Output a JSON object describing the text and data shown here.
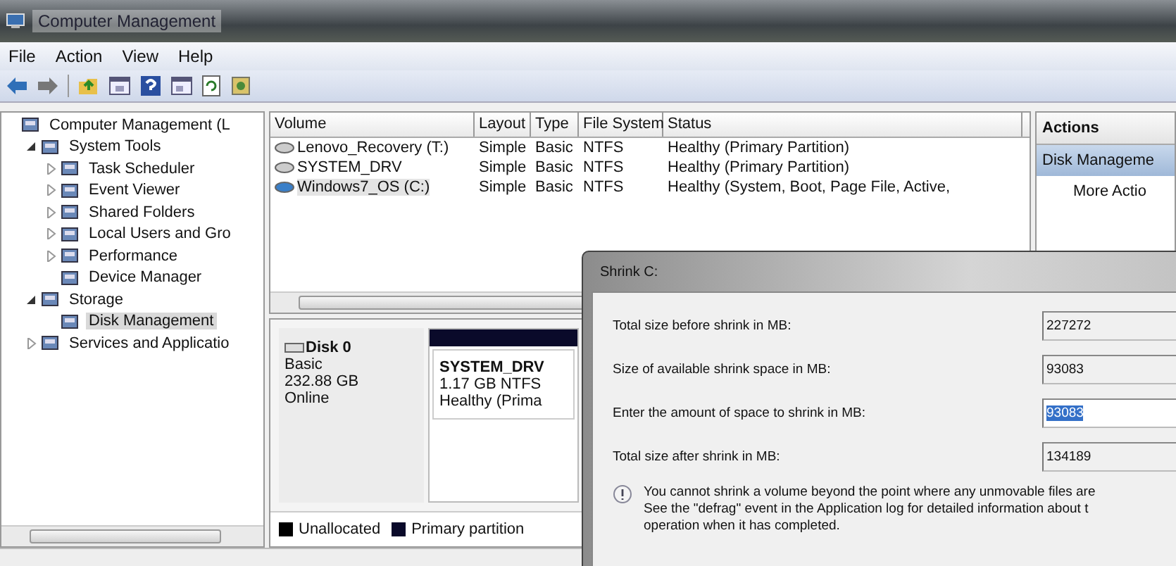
{
  "window": {
    "title": "Computer Management"
  },
  "menu": [
    {
      "label": "File"
    },
    {
      "label": "Action"
    },
    {
      "label": "View"
    },
    {
      "label": "Help"
    }
  ],
  "tree": [
    {
      "label": "Computer Management (L",
      "selected": false,
      "children": [
        {
          "label": "System Tools",
          "selected": false,
          "expanded": true,
          "children": [
            {
              "label": "Task Scheduler",
              "selected": false,
              "expanded": false
            },
            {
              "label": "Event Viewer",
              "selected": false,
              "expanded": false
            },
            {
              "label": "Shared Folders",
              "selected": false,
              "expanded": false
            },
            {
              "label": "Local Users and Gro",
              "selected": false,
              "expanded": false
            },
            {
              "label": "Performance",
              "selected": false,
              "expanded": false
            },
            {
              "label": "Device Manager",
              "selected": false
            }
          ]
        },
        {
          "label": "Storage",
          "selected": false,
          "expanded": true,
          "children": [
            {
              "label": "Disk Management",
              "selected": true
            }
          ]
        },
        {
          "label": "Services and Applicatio",
          "selected": false,
          "expanded": false
        }
      ]
    }
  ],
  "volumes": {
    "columns": [
      "Volume",
      "Layout",
      "Type",
      "File System",
      "Status"
    ],
    "rows": [
      {
        "cells": [
          "Lenovo_Recovery (T:)",
          "Simple",
          "Basic",
          "NTFS",
          "Healthy (Primary Partition)"
        ],
        "selected": false
      },
      {
        "cells": [
          "SYSTEM_DRV",
          "Simple",
          "Basic",
          "NTFS",
          "Healthy (Primary Partition)"
        ],
        "selected": false
      },
      {
        "cells": [
          "Windows7_OS (C:)",
          "Simple",
          "Basic",
          "NTFS",
          "Healthy (System, Boot, Page File, Active,"
        ],
        "selected": true
      }
    ]
  },
  "actions": {
    "title": "Actions",
    "items": [
      {
        "label": "Disk Manageme",
        "kind": "section"
      },
      {
        "label": "More Actio",
        "kind": "action"
      }
    ]
  },
  "disk": {
    "name": "Disk 0",
    "type": "Basic",
    "size": "232.88 GB",
    "status": "Online",
    "partitions": [
      {
        "name": "SYSTEM_DRV",
        "size": "1.17 GB NTFS",
        "status": "Healthy (Prima",
        "color": "#0a0a2a"
      }
    ]
  },
  "legend": [
    {
      "label": "Unallocated",
      "color": "#000000"
    },
    {
      "label": "Primary partition",
      "color": "#0a0a2a"
    }
  ],
  "dialog": {
    "title": "Shrink C:",
    "fields": [
      {
        "label": "Total size before shrink in MB:",
        "value": "227272",
        "kind": "readonly"
      },
      {
        "label": "Size of available shrink space in MB:",
        "value": "93083",
        "kind": "readonly"
      },
      {
        "label": "Enter the amount of space to shrink in MB:",
        "value": "93083",
        "kind": "input",
        "selected": true
      },
      {
        "label": "Total size after shrink in MB:",
        "value": "134189",
        "kind": "readonly"
      }
    ],
    "note_lines": [
      "You cannot shrink a volume beyond the point where any unmovable files are",
      "See the \"defrag\" event in the Application log for detailed information about t",
      "operation when it has completed."
    ]
  }
}
